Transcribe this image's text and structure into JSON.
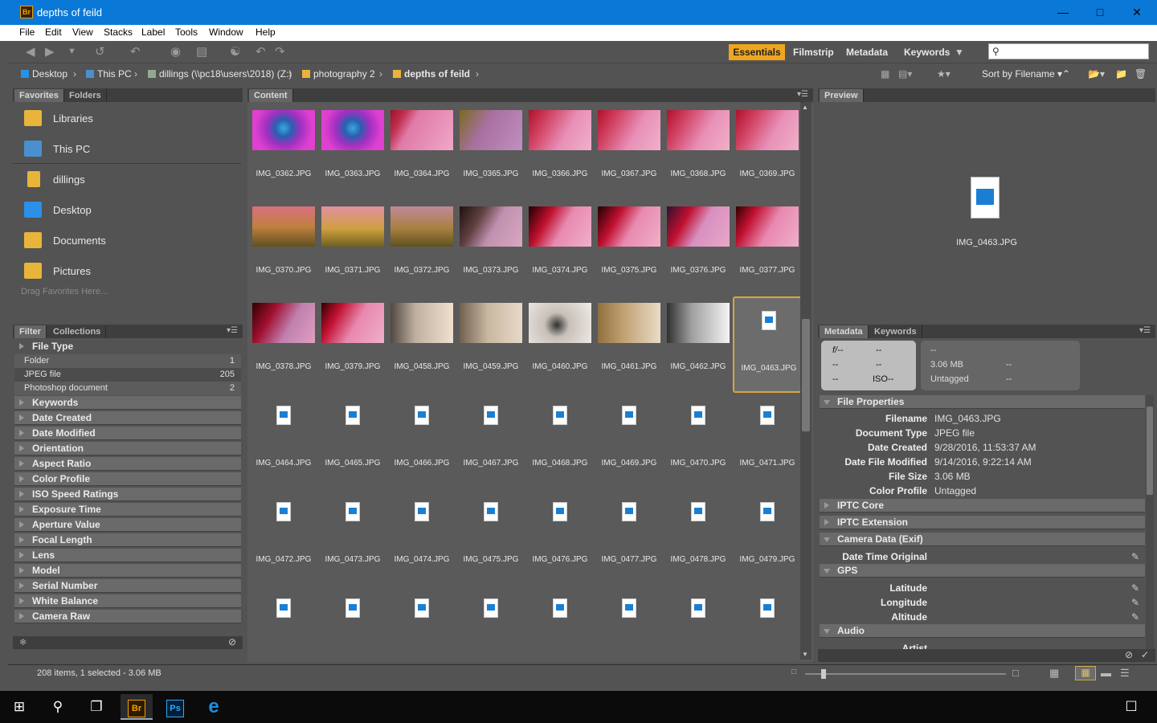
{
  "window": {
    "title": "depths of feild",
    "app_icon": "Br",
    "controls": [
      "minimize",
      "maximize",
      "close"
    ]
  },
  "menu": [
    "File",
    "Edit",
    "View",
    "Stacks",
    "Label",
    "Tools",
    "Window",
    "Help"
  ],
  "workspaces": {
    "active": "Essentials",
    "items": [
      "Essentials",
      "Filmstrip",
      "Metadata",
      "Keywords"
    ]
  },
  "search": {
    "placeholder": ""
  },
  "breadcrumb": [
    "Desktop",
    "This PC",
    "dillings (\\\\pc18\\users\\2018) (Z:)",
    "photography 2",
    "depths of feild"
  ],
  "sort": {
    "label": "Sort by Filename"
  },
  "favorites_panel": {
    "tabs": [
      "Favorites",
      "Folders"
    ],
    "items": [
      "Libraries",
      "This PC",
      "dillings",
      "Desktop",
      "Documents",
      "Pictures"
    ],
    "drag_hint": "Drag Favorites Here..."
  },
  "filter_panel": {
    "tabs": [
      "Filter",
      "Collections"
    ],
    "file_type_header": "File Type",
    "file_types": [
      {
        "label": "Folder",
        "count": "1"
      },
      {
        "label": "JPEG file",
        "count": "205"
      },
      {
        "label": "Photoshop document",
        "count": "2"
      }
    ],
    "criteria": [
      "Keywords",
      "Date Created",
      "Date Modified",
      "Orientation",
      "Aspect Ratio",
      "Color Profile",
      "ISO Speed Ratings",
      "Exposure Time",
      "Aperture Value",
      "Focal Length",
      "Lens",
      "Model",
      "Serial Number",
      "White Balance",
      "Camera Raw"
    ]
  },
  "content_panel": {
    "tab": "Content",
    "thumbs": [
      "IMG_0362.JPG",
      "IMG_0363.JPG",
      "IMG_0364.JPG",
      "IMG_0365.JPG",
      "IMG_0366.JPG",
      "IMG_0367.JPG",
      "IMG_0368.JPG",
      "IMG_0369.JPG",
      "IMG_0370.JPG",
      "IMG_0371.JPG",
      "IMG_0372.JPG",
      "IMG_0373.JPG",
      "IMG_0374.JPG",
      "IMG_0375.JPG",
      "IMG_0376.JPG",
      "IMG_0377.JPG",
      "IMG_0378.JPG",
      "IMG_0379.JPG",
      "IMG_0458.JPG",
      "IMG_0459.JPG",
      "IMG_0460.JPG",
      "IMG_0461.JPG",
      "IMG_0462.JPG",
      "IMG_0463.JPG",
      "IMG_0464.JPG",
      "IMG_0465.JPG",
      "IMG_0466.JPG",
      "IMG_0467.JPG",
      "IMG_0468.JPG",
      "IMG_0469.JPG",
      "IMG_0470.JPG",
      "IMG_0471.JPG",
      "IMG_0472.JPG",
      "IMG_0473.JPG",
      "IMG_0474.JPG",
      "IMG_0475.JPG",
      "IMG_0476.JPG",
      "IMG_0477.JPG",
      "IMG_0478.JPG",
      "IMG_0479.JPG",
      "",
      "",
      "",
      "",
      "",
      "",
      "",
      ""
    ],
    "selected": "IMG_0463.JPG"
  },
  "preview_panel": {
    "tab": "Preview",
    "filename": "IMG_0463.JPG"
  },
  "metadata_panel": {
    "tabs": [
      "Metadata",
      "Keywords"
    ],
    "camera_summary": {
      "aperture": "f/--",
      "shutter": "--",
      "a": "--",
      "b": "--",
      "c": "--",
      "iso": "ISO--"
    },
    "file_summary": {
      "top": "--",
      "size": "3.06 MB",
      "size_r": "--",
      "profile": "Untagged",
      "profile_r": "--"
    },
    "file_properties_header": "File Properties",
    "file_properties": [
      {
        "k": "Filename",
        "v": "IMG_0463.JPG"
      },
      {
        "k": "Document Type",
        "v": "JPEG file"
      },
      {
        "k": "Date Created",
        "v": "9/28/2016, 11:53:37 AM"
      },
      {
        "k": "Date File Modified",
        "v": "9/14/2016, 9:22:14 AM"
      },
      {
        "k": "File Size",
        "v": "3.06 MB"
      },
      {
        "k": "Color Profile",
        "v": "Untagged"
      }
    ],
    "sections": [
      "IPTC Core",
      "IPTC Extension",
      "Camera Data (Exif)"
    ],
    "exif_field": "Date Time Original",
    "gps_header": "GPS",
    "gps_fields": [
      "Latitude",
      "Longitude",
      "Altitude"
    ],
    "audio_header": "Audio",
    "audio_field": "Artist"
  },
  "status": {
    "text": "208 items, 1 selected - 3.06 MB"
  }
}
